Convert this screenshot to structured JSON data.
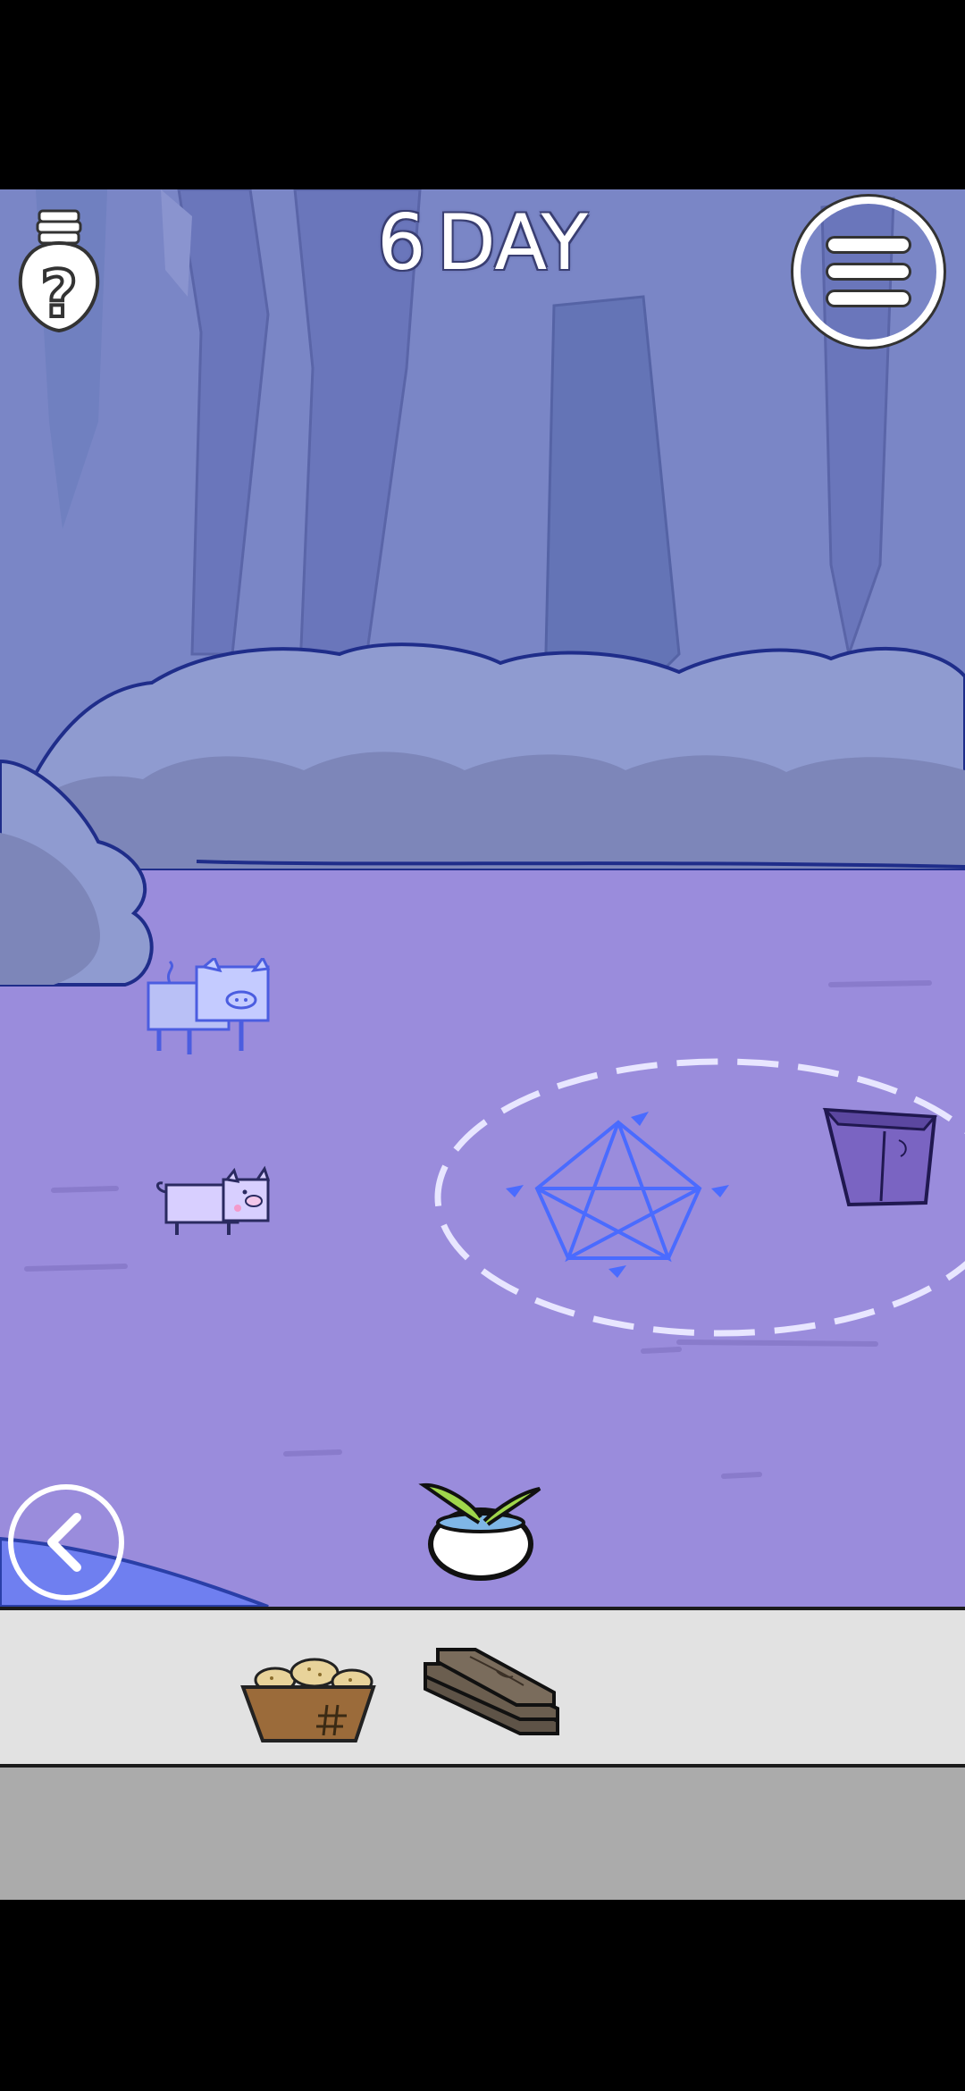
{
  "header": {
    "day_number": "6",
    "day_suffix": "DAY"
  },
  "buttons": {
    "hint_icon": "lightbulb-question-icon",
    "menu_icon": "hamburger-menu-icon",
    "back_icon": "chevron-left-icon"
  },
  "scene": {
    "objects": [
      "ghost-pig",
      "pig",
      "pentagram-circle",
      "wooden-box",
      "sprout-pot"
    ]
  },
  "inventory": {
    "items": [
      {
        "name": "bread-basket",
        "icon": "bread-basket-icon"
      },
      {
        "name": "wooden-planks",
        "icon": "wooden-planks-icon"
      }
    ]
  },
  "colors": {
    "sky": "#7a86c6",
    "ground": "#9a8cdc",
    "bushes": "#7d86b9",
    "inventory_bg": "#e2e2e2"
  }
}
